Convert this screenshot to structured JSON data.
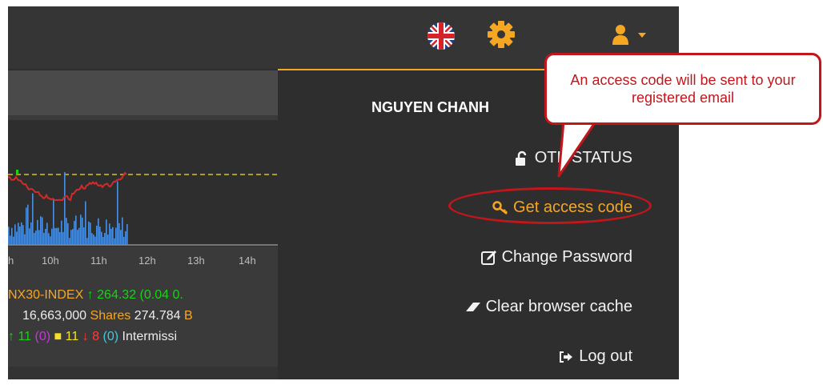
{
  "header": {
    "language_icon": "uk-flag-icon",
    "settings_icon": "gear-icon",
    "user_icon": "user-icon",
    "accent": "#f5a623"
  },
  "chart": {
    "time_ticks": [
      "h",
      "10h",
      "11h",
      "12h",
      "13h",
      "14h"
    ],
    "index_name": "NX30-INDEX",
    "index_value": "264.32",
    "index_change": "(0.04 0.",
    "volume": "16,663,000",
    "volume_label": "Shares",
    "value": "274.784",
    "value_unit": "B",
    "up_count": "11",
    "up_ceiling": "(0)",
    "ref_count": "11",
    "down_count": "8",
    "down_floor": "(0)",
    "status": "Intermissi"
  },
  "menu": {
    "user_name": "NGUYEN CHANH",
    "otp_status": "OTP STATUS",
    "get_access_code": "Get access code",
    "change_password": "Change Password",
    "clear_cache": "Clear browser cache",
    "log_out": "Log out"
  },
  "annotation": {
    "callout": "An access code will be sent to your registered email",
    "highlight_color": "#c0161c"
  }
}
